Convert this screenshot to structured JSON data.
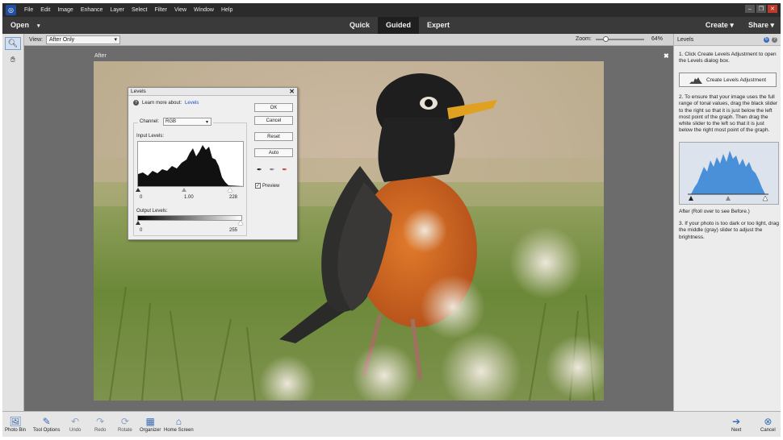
{
  "menubar": {
    "items": [
      "File",
      "Edit",
      "Image",
      "Enhance",
      "Layer",
      "Select",
      "Filter",
      "View",
      "Window",
      "Help"
    ]
  },
  "modebar": {
    "open_label": "Open",
    "modes": [
      "Quick",
      "Guided",
      "Expert"
    ],
    "active_mode": "Guided",
    "create_label": "Create",
    "share_label": "Share"
  },
  "options": {
    "view_label": "View:",
    "view_value": "After Only",
    "zoom_label": "Zoom:",
    "zoom_value": "64%",
    "zoom_fraction": 0.2
  },
  "canvas": {
    "caption": "After"
  },
  "levels_dialog": {
    "title": "Levels",
    "learn_label": "Learn more about:",
    "learn_link": "Levels",
    "channel_label": "Channel:",
    "channel_value": "RGB",
    "input_levels_label": "Input Levels:",
    "input_black": "0",
    "input_gray": "1.00",
    "input_white": "228",
    "output_levels_label": "Output Levels:",
    "output_black": "0",
    "output_white": "255",
    "buttons": {
      "ok": "OK",
      "cancel": "Cancel",
      "reset": "Reset",
      "auto": "Auto"
    },
    "preview_label": "Preview",
    "preview_checked": true
  },
  "panel": {
    "title": "Levels",
    "step1": "1. Click Create Levels Adjustment to open the Levels dialog box.",
    "create_button": "Create Levels Adjustment",
    "step2": "2. To ensure that your image uses the full range of tonal values, drag the black slider to the right so that it is just below the left most point of the graph. Then drag the white slider to the left so that it is just below the right most point of the graph.",
    "after_note": "After (Roll over to see Before.)",
    "step3": "3. If your photo is too dark or too light, drag the middle (gray) slider to adjust the brightness."
  },
  "bottombar": {
    "items": [
      {
        "label": "Photo Bin",
        "icon": "photo-bin-icon"
      },
      {
        "label": "Tool Options",
        "icon": "tool-options-icon"
      },
      {
        "label": "Undo",
        "icon": "undo-icon"
      },
      {
        "label": "Redo",
        "icon": "redo-icon"
      },
      {
        "label": "Rotate",
        "icon": "rotate-icon"
      },
      {
        "label": "Organizer",
        "icon": "organizer-icon"
      },
      {
        "label": "Home Screen",
        "icon": "home-icon"
      }
    ],
    "next_label": "Next",
    "cancel_label": "Cancel"
  },
  "colors": {
    "menubar_bg": "#2b2b2b",
    "modebar_bg": "#3a3a3a",
    "accent_blue": "#3a6db5",
    "histogram_blue": "#4a90d9"
  }
}
